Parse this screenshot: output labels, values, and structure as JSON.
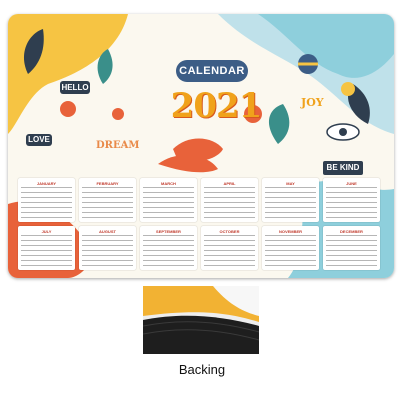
{
  "product": {
    "title_badge": "CALENDAR",
    "year": "2021",
    "stickers": {
      "hello": "HELLO",
      "dream": "DREAM",
      "joy": "JOY",
      "be_kind": "BE KIND",
      "love": "LOVE"
    },
    "months": [
      "JANUARY",
      "FEBRUARY",
      "MARCH",
      "APRIL",
      "MAY",
      "JUNE",
      "JULY",
      "AUGUST",
      "SEPTEMBER",
      "OCTOBER",
      "NOVEMBER",
      "DECEMBER"
    ]
  },
  "detail": {
    "caption": "Backing"
  },
  "colors": {
    "accent_yellow": "#f0a21b",
    "accent_orange": "#e8623a",
    "accent_blue": "#3c5d86",
    "accent_teal": "#7ec8d8",
    "month_header_red": "#c0392b"
  }
}
